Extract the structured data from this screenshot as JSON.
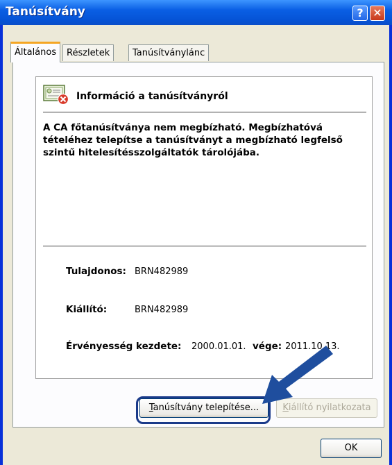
{
  "window": {
    "title": "Tanúsítvány",
    "help_glyph": "?",
    "close_glyph": "✕"
  },
  "tabs": [
    {
      "label": "Általános",
      "active": true
    },
    {
      "label": "Részletek",
      "active": false
    },
    {
      "label": "Tanúsítványlánc",
      "active": false
    }
  ],
  "info": {
    "title": "Információ a tanúsítványról",
    "warning": "A CA főtanúsítványa nem megbízható. Megbízhatóvá tételéhez telepítse a tanúsítványt a megbízható legfelső szintű hitelesítésszolgáltatók tárolójába."
  },
  "fields": {
    "owner_label": "Tulajdonos:",
    "owner_value": "BRN482989",
    "issuer_label": "Kiállító:",
    "issuer_value": "BRN482989",
    "validity_from_label": "Érvényesség kezdete:",
    "validity_from_value": "2000.01.01.",
    "validity_to_label": "vége:",
    "validity_to_value": "2011.10.13."
  },
  "buttons": {
    "install_first": "T",
    "install_rest": "anúsítvány telepítése...",
    "issuer_statement_first": "K",
    "issuer_statement_rest": "iállító nyilatkozata",
    "ok": "OK"
  },
  "colors": {
    "titlebar": "#0553d6",
    "highlight": "#1a3a8a",
    "arrow": "#1f4e9e",
    "tab_accent": "#f5a623"
  }
}
